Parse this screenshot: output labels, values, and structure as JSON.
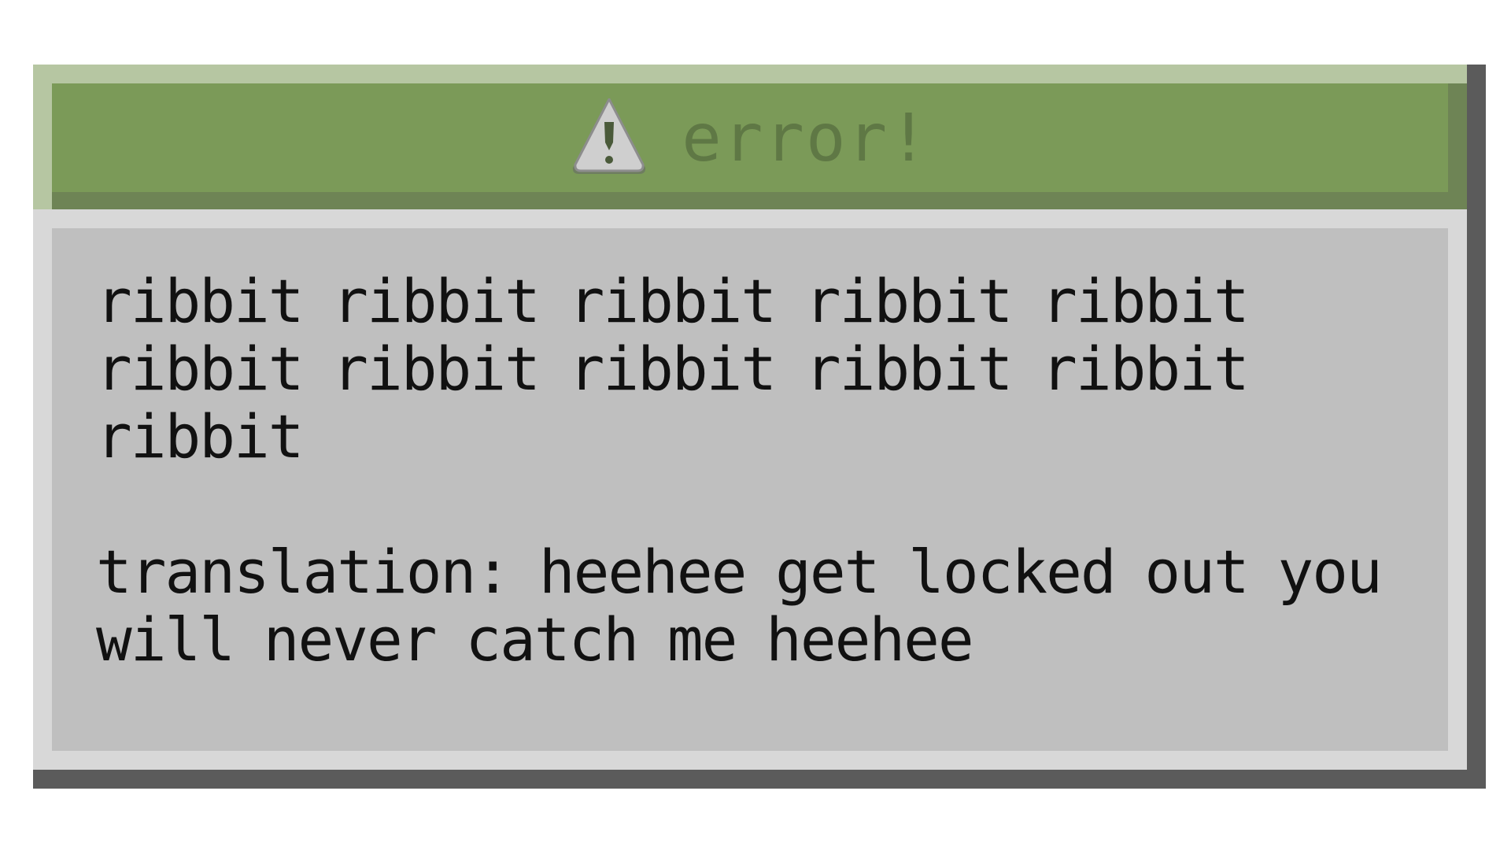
{
  "dialog": {
    "title": "error!",
    "icon": "warning-icon",
    "message_line1": "ribbit ribbit ribbit ribbit ribbit ribbit ribbit ribbit ribbit ribbit ribbit",
    "message_line2": "translation: heehee get locked out you will never catch me heehee"
  },
  "colors": {
    "titlebar": "#7b9a58",
    "title_text": "#5f7845",
    "body": "#bfbfbf",
    "text": "#111111"
  }
}
